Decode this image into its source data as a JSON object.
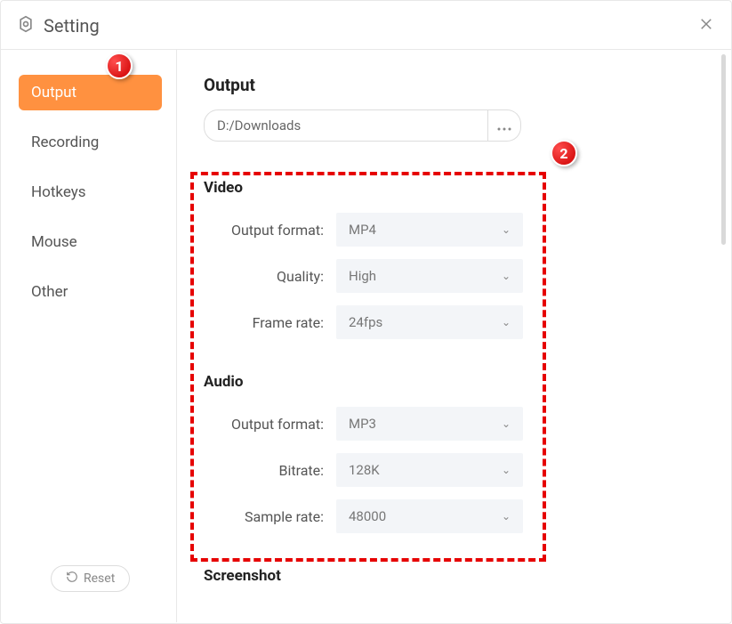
{
  "header": {
    "title": "Setting"
  },
  "sidebar": {
    "items": [
      {
        "label": "Output",
        "active": true
      },
      {
        "label": "Recording",
        "active": false
      },
      {
        "label": "Hotkeys",
        "active": false
      },
      {
        "label": "Mouse",
        "active": false
      },
      {
        "label": "Other",
        "active": false
      }
    ],
    "reset_label": "Reset"
  },
  "content": {
    "output": {
      "title": "Output",
      "path": "D:/Downloads"
    },
    "video": {
      "title": "Video",
      "format_label": "Output format:",
      "format_value": "MP4",
      "quality_label": "Quality:",
      "quality_value": "High",
      "framerate_label": "Frame rate:",
      "framerate_value": "24fps"
    },
    "audio": {
      "title": "Audio",
      "format_label": "Output format:",
      "format_value": "MP3",
      "bitrate_label": "Bitrate:",
      "bitrate_value": "128K",
      "samplerate_label": "Sample rate:",
      "samplerate_value": "48000"
    },
    "screenshot": {
      "title": "Screenshot"
    }
  },
  "annotations": {
    "badge1": "1",
    "badge2": "2"
  }
}
